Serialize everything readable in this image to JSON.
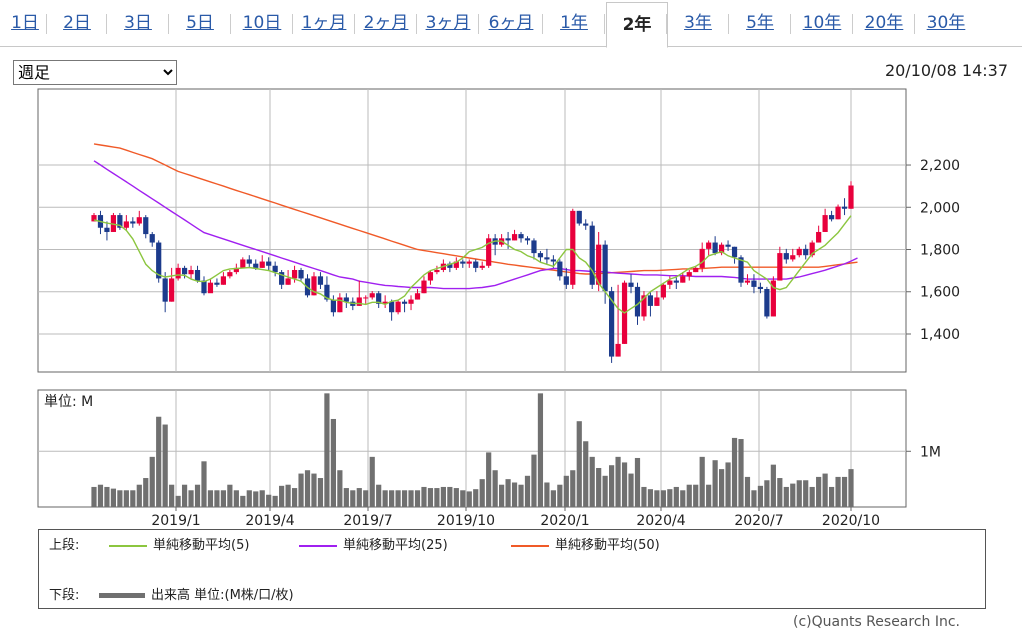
{
  "tabs": [
    "1日",
    "2日",
    "3日",
    "5日",
    "10日",
    "1ヶ月",
    "2ヶ月",
    "3ヶ月",
    "6ヶ月",
    "1年",
    "2年",
    "3年",
    "5年",
    "10年",
    "20年",
    "30年"
  ],
  "active_tab": "2年",
  "period_select": {
    "value": "週足",
    "options": [
      "週足"
    ]
  },
  "timestamp": "20/10/08 14:37",
  "chart_data": {
    "type": "candlestick",
    "price_axis": {
      "ticks": [
        1400,
        1600,
        1800,
        2000,
        2200
      ],
      "ylim": [
        1220,
        2560
      ]
    },
    "volume_axis": {
      "unit_label": "単位: M",
      "ticks": [
        {
          "value": 1,
          "label": "1M"
        }
      ],
      "ylim": [
        0,
        2.1
      ]
    },
    "x_tick_labels": [
      "2019/1",
      "2019/4",
      "2019/7",
      "2019/10",
      "2020/1",
      "2020/4",
      "2020/7",
      "2020/10"
    ],
    "colors": {
      "up": "#e8003c",
      "down": "#1c3b8c",
      "ma5": "#8cc63f",
      "ma25": "#a020f0",
      "ma50": "#f05a28",
      "volume": "#707070",
      "grid": "#bbbbbb"
    },
    "candles": [
      [
        1933,
        1963,
        1933,
        1973,
        0.36
      ],
      [
        1963,
        1903,
        1873,
        1983,
        0.4
      ],
      [
        1903,
        1883,
        1843,
        1933,
        0.36
      ],
      [
        1883,
        1963,
        1883,
        1973,
        0.33
      ],
      [
        1963,
        1903,
        1893,
        1973,
        0.3
      ],
      [
        1903,
        1933,
        1893,
        1963,
        0.3
      ],
      [
        1933,
        1923,
        1903,
        1953,
        0.3
      ],
      [
        1923,
        1953,
        1913,
        1983,
        0.4
      ],
      [
        1953,
        1873,
        1853,
        1963,
        0.52
      ],
      [
        1873,
        1833,
        1813,
        1883,
        0.9
      ],
      [
        1833,
        1663,
        1643,
        1843,
        1.62
      ],
      [
        1663,
        1553,
        1503,
        1693,
        1.48
      ],
      [
        1553,
        1663,
        1553,
        1713,
        0.4
      ],
      [
        1663,
        1713,
        1653,
        1733,
        0.2
      ],
      [
        1713,
        1683,
        1663,
        1723,
        0.4
      ],
      [
        1683,
        1703,
        1663,
        1723,
        0.3
      ],
      [
        1703,
        1653,
        1643,
        1723,
        0.4
      ],
      [
        1653,
        1593,
        1583,
        1673,
        0.82
      ],
      [
        1593,
        1643,
        1603,
        1663,
        0.3
      ],
      [
        1643,
        1633,
        1623,
        1663,
        0.3
      ],
      [
        1633,
        1673,
        1633,
        1693,
        0.3
      ],
      [
        1673,
        1693,
        1663,
        1703,
        0.4
      ],
      [
        1693,
        1713,
        1683,
        1733,
        0.3
      ],
      [
        1713,
        1753,
        1713,
        1763,
        0.2
      ],
      [
        1753,
        1733,
        1713,
        1773,
        0.3
      ],
      [
        1733,
        1713,
        1703,
        1753,
        0.28
      ],
      [
        1713,
        1743,
        1713,
        1773,
        0.3
      ],
      [
        1743,
        1723,
        1703,
        1763,
        0.22
      ],
      [
        1723,
        1693,
        1673,
        1743,
        0.2
      ],
      [
        1693,
        1633,
        1613,
        1703,
        0.38
      ],
      [
        1633,
        1663,
        1633,
        1703,
        0.4
      ],
      [
        1663,
        1703,
        1643,
        1723,
        0.34
      ],
      [
        1703,
        1663,
        1653,
        1713,
        0.6
      ],
      [
        1663,
        1583,
        1573,
        1683,
        0.66
      ],
      [
        1583,
        1673,
        1583,
        1693,
        0.6
      ],
      [
        1673,
        1633,
        1613,
        1693,
        0.52
      ],
      [
        1633,
        1563,
        1553,
        1673,
        2.04
      ],
      [
        1563,
        1503,
        1483,
        1583,
        1.58
      ],
      [
        1503,
        1573,
        1503,
        1593,
        0.66
      ],
      [
        1573,
        1553,
        1523,
        1593,
        0.34
      ],
      [
        1553,
        1533,
        1513,
        1573,
        0.3
      ],
      [
        1533,
        1573,
        1533,
        1653,
        0.34
      ],
      [
        1573,
        1573,
        1543,
        1583,
        0.3
      ],
      [
        1573,
        1593,
        1563,
        1603,
        0.9
      ],
      [
        1593,
        1543,
        1523,
        1603,
        0.4
      ],
      [
        1543,
        1553,
        1523,
        1583,
        0.3
      ],
      [
        1553,
        1503,
        1463,
        1563,
        0.3
      ],
      [
        1503,
        1553,
        1493,
        1563,
        0.3
      ],
      [
        1553,
        1543,
        1503,
        1563,
        0.3
      ],
      [
        1543,
        1563,
        1513,
        1583,
        0.3
      ],
      [
        1563,
        1593,
        1563,
        1613,
        0.3
      ],
      [
        1593,
        1653,
        1593,
        1673,
        0.36
      ],
      [
        1653,
        1693,
        1633,
        1703,
        0.34
      ],
      [
        1693,
        1703,
        1683,
        1723,
        0.34
      ],
      [
        1703,
        1733,
        1693,
        1753,
        0.36
      ],
      [
        1733,
        1713,
        1693,
        1743,
        0.36
      ],
      [
        1713,
        1743,
        1703,
        1763,
        0.34
      ],
      [
        1743,
        1733,
        1713,
        1753,
        0.3
      ],
      [
        1733,
        1743,
        1713,
        1753,
        0.28
      ],
      [
        1743,
        1713,
        1693,
        1753,
        0.32
      ],
      [
        1713,
        1723,
        1703,
        1743,
        0.5
      ],
      [
        1723,
        1853,
        1713,
        1873,
        0.98
      ],
      [
        1853,
        1823,
        1773,
        1873,
        0.66
      ],
      [
        1823,
        1853,
        1813,
        1873,
        0.4
      ],
      [
        1853,
        1843,
        1803,
        1883,
        0.5
      ],
      [
        1843,
        1873,
        1843,
        1893,
        0.44
      ],
      [
        1873,
        1853,
        1833,
        1883,
        0.4
      ],
      [
        1853,
        1843,
        1823,
        1863,
        0.56
      ],
      [
        1843,
        1783,
        1753,
        1853,
        0.94
      ],
      [
        1783,
        1763,
        1743,
        1793,
        2.04
      ],
      [
        1763,
        1753,
        1733,
        1803,
        0.44
      ],
      [
        1753,
        1743,
        1713,
        1773,
        0.3
      ],
      [
        1743,
        1673,
        1653,
        1753,
        0.4
      ],
      [
        1673,
        1633,
        1613,
        1713,
        0.56
      ],
      [
        1633,
        1983,
        1613,
        1993,
        0.66
      ],
      [
        1983,
        1923,
        1913,
        1983,
        1.54
      ],
      [
        1923,
        1913,
        1893,
        1943,
        1.18
      ],
      [
        1913,
        1633,
        1613,
        1933,
        0.9
      ],
      [
        1633,
        1823,
        1603,
        1883,
        0.7
      ],
      [
        1823,
        1603,
        1543,
        1843,
        0.56
      ],
      [
        1603,
        1293,
        1263,
        1623,
        0.75
      ],
      [
        1293,
        1353,
        1293,
        1633,
        0.9
      ],
      [
        1353,
        1643,
        1353,
        1653,
        0.8
      ],
      [
        1643,
        1623,
        1593,
        1683,
        0.6
      ],
      [
        1623,
        1483,
        1443,
        1643,
        0.88
      ],
      [
        1483,
        1583,
        1463,
        1603,
        0.36
      ],
      [
        1583,
        1533,
        1483,
        1603,
        0.32
      ],
      [
        1533,
        1573,
        1533,
        1603,
        0.3
      ],
      [
        1573,
        1633,
        1563,
        1643,
        0.3
      ],
      [
        1633,
        1653,
        1613,
        1673,
        0.32
      ],
      [
        1653,
        1643,
        1613,
        1673,
        0.36
      ],
      [
        1643,
        1673,
        1643,
        1693,
        0.3
      ],
      [
        1673,
        1693,
        1653,
        1703,
        0.4
      ],
      [
        1693,
        1713,
        1693,
        1723,
        0.4
      ],
      [
        1713,
        1803,
        1693,
        1833,
        0.9
      ],
      [
        1803,
        1833,
        1773,
        1843,
        0.4
      ],
      [
        1833,
        1783,
        1773,
        1863,
        0.84
      ],
      [
        1783,
        1823,
        1773,
        1833,
        0.68
      ],
      [
        1823,
        1813,
        1793,
        1843,
        0.8
      ],
      [
        1813,
        1763,
        1733,
        1813,
        1.24
      ],
      [
        1763,
        1643,
        1623,
        1773,
        1.22
      ],
      [
        1643,
        1653,
        1633,
        1683,
        0.54
      ],
      [
        1653,
        1623,
        1593,
        1683,
        0.3
      ],
      [
        1623,
        1613,
        1593,
        1643,
        0.38
      ],
      [
        1613,
        1483,
        1473,
        1623,
        0.48
      ],
      [
        1483,
        1653,
        1483,
        1673,
        0.76
      ],
      [
        1653,
        1783,
        1653,
        1813,
        0.52
      ],
      [
        1783,
        1753,
        1733,
        1803,
        0.36
      ],
      [
        1753,
        1773,
        1743,
        1803,
        0.42
      ],
      [
        1773,
        1803,
        1763,
        1813,
        0.48
      ],
      [
        1803,
        1773,
        1753,
        1823,
        0.48
      ],
      [
        1773,
        1833,
        1763,
        1843,
        0.36
      ],
      [
        1833,
        1883,
        1833,
        1913,
        0.54
      ],
      [
        1883,
        1963,
        1883,
        1993,
        0.6
      ],
      [
        1963,
        1943,
        1933,
        1983,
        0.36
      ],
      [
        1943,
        2003,
        1943,
        2013,
        0.54
      ],
      [
        2003,
        1993,
        1963,
        2043,
        0.54
      ],
      [
        1993,
        2103,
        1993,
        2123,
        0.68
      ]
    ],
    "ma5": [
      1940,
      1932,
      1925,
      1920,
      1914,
      1890,
      1850,
      1790,
      1730,
      1700,
      1680,
      1670,
      1675,
      1680,
      1678,
      1660,
      1650,
      1648,
      1660,
      1680,
      1700,
      1708,
      1710,
      1712,
      1715,
      1710,
      1705,
      1700,
      1690,
      1680,
      1670,
      1660,
      1650,
      1620,
      1600,
      1590,
      1570,
      1560,
      1560,
      1550,
      1545,
      1545,
      1540,
      1550,
      1550,
      1540,
      1555,
      1560,
      1580,
      1620,
      1650,
      1680,
      1700,
      1710,
      1720,
      1730,
      1740,
      1760,
      1790,
      1800,
      1810,
      1830,
      1840,
      1840,
      1820,
      1800,
      1790,
      1770,
      1760,
      1740,
      1730,
      1720,
      1760,
      1800,
      1800,
      1760,
      1740,
      1700,
      1640,
      1600,
      1560,
      1520,
      1500,
      1520,
      1540,
      1570,
      1600,
      1620,
      1640,
      1660,
      1670,
      1690,
      1710,
      1720,
      1740,
      1770,
      1780,
      1790,
      1770,
      1760,
      1750,
      1740,
      1700,
      1680,
      1660,
      1620,
      1610,
      1620,
      1660,
      1700,
      1740,
      1780,
      1800,
      1820,
      1850,
      1880,
      1920,
      1960
    ],
    "ma25": [
      2220,
      2200,
      2180,
      2160,
      2140,
      2120,
      2100,
      2080,
      2060,
      2040,
      2020,
      2000,
      1980,
      1960,
      1940,
      1920,
      1900,
      1880,
      1870,
      1860,
      1850,
      1840,
      1830,
      1820,
      1810,
      1800,
      1790,
      1780,
      1770,
      1760,
      1750,
      1740,
      1730,
      1720,
      1710,
      1700,
      1690,
      1680,
      1670,
      1665,
      1660,
      1650,
      1645,
      1640,
      1635,
      1630,
      1628,
      1625,
      1623,
      1620,
      1620,
      1620,
      1620,
      1618,
      1615,
      1615,
      1615,
      1615,
      1615,
      1618,
      1620,
      1625,
      1630,
      1640,
      1650,
      1660,
      1670,
      1680,
      1690,
      1700,
      1705,
      1710,
      1710,
      1705,
      1700,
      1700,
      1698,
      1696,
      1696,
      1694,
      1690,
      1688,
      1686,
      1684,
      1682,
      1680,
      1680,
      1680,
      1678,
      1676,
      1676,
      1676,
      1674,
      1672,
      1672,
      1672,
      1672,
      1672,
      1670,
      1668,
      1664,
      1660,
      1660,
      1660,
      1660,
      1660,
      1660,
      1660,
      1665,
      1670,
      1678,
      1686,
      1694,
      1702,
      1712,
      1722,
      1732,
      1745,
      1760
    ],
    "ma50": [
      2300,
      2295,
      2290,
      2285,
      2280,
      2270,
      2260,
      2250,
      2240,
      2230,
      2215,
      2200,
      2185,
      2170,
      2160,
      2150,
      2140,
      2130,
      2120,
      2110,
      2100,
      2090,
      2080,
      2070,
      2060,
      2050,
      2040,
      2030,
      2020,
      2010,
      2000,
      1990,
      1980,
      1970,
      1960,
      1950,
      1940,
      1930,
      1920,
      1910,
      1900,
      1890,
      1880,
      1870,
      1860,
      1850,
      1840,
      1830,
      1820,
      1810,
      1800,
      1795,
      1790,
      1785,
      1780,
      1775,
      1770,
      1765,
      1760,
      1755,
      1750,
      1745,
      1740,
      1735,
      1730,
      1726,
      1722,
      1718,
      1714,
      1710,
      1706,
      1702,
      1698,
      1694,
      1690,
      1686,
      1684,
      1684,
      1686,
      1688,
      1690,
      1692,
      1694,
      1696,
      1698,
      1700,
      1700,
      1700,
      1702,
      1704,
      1706,
      1708,
      1708,
      1708,
      1710,
      1712,
      1714,
      1716,
      1716,
      1716,
      1716,
      1716,
      1716,
      1716,
      1716,
      1716,
      1716,
      1716,
      1716,
      1716,
      1716,
      1716,
      1716,
      1720,
      1724,
      1728,
      1732,
      1736,
      1740
    ]
  },
  "legend": {
    "upper_label": "上段:",
    "ma5_label": "単純移動平均(5)",
    "ma25_label": "単純移動平均(25)",
    "ma50_label": "単純移動平均(50)",
    "lower_label": "下段:",
    "volume_label": "出来高 単位:(M株/口/枚)"
  },
  "copyright": "(c)Quants Research Inc."
}
